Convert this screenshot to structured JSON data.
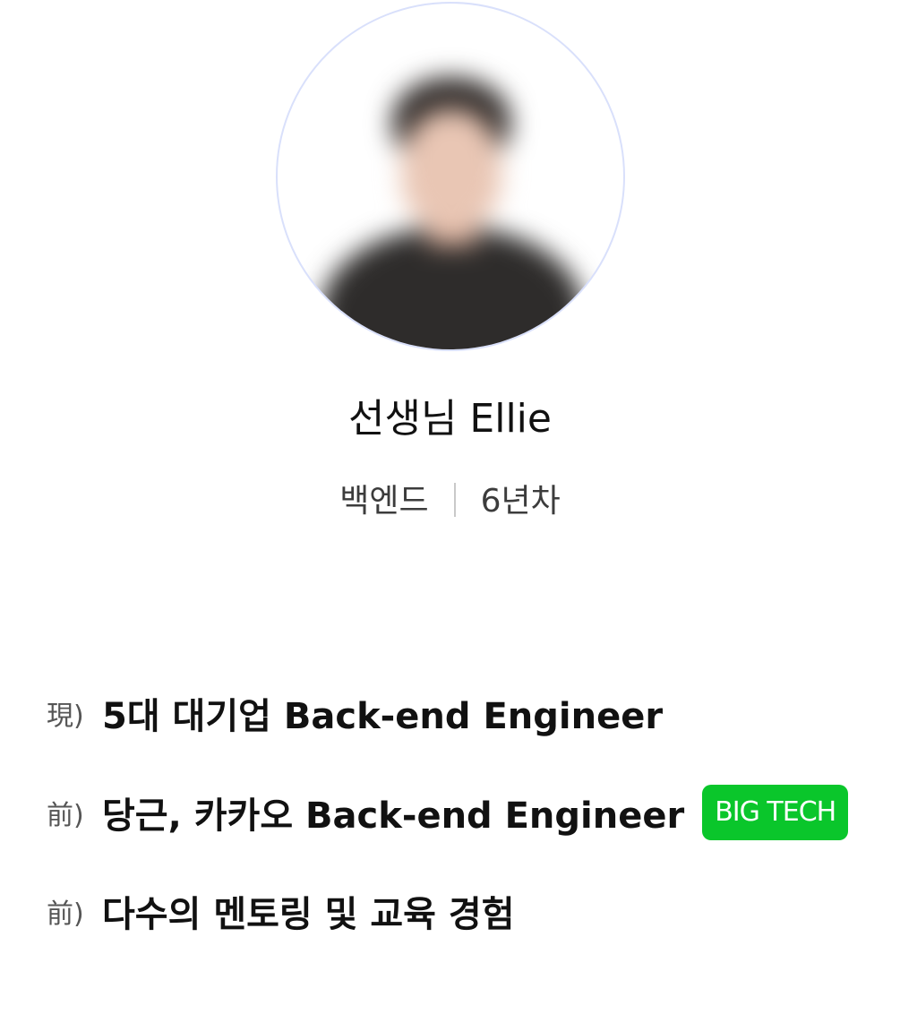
{
  "profile": {
    "avatar_alt": "profile photo",
    "name": "선생님 Ellie",
    "field": "백엔드",
    "experience": "6년차"
  },
  "career": [
    {
      "prefix": "現)",
      "text": "5대 대기업 Back-end Engineer"
    },
    {
      "prefix": "前)",
      "text": "당근, 카카오 Back-end Engineer",
      "badge": "BIG TECH"
    },
    {
      "prefix": "前)",
      "text": "다수의 멘토링 및 교육 경험"
    }
  ],
  "colors": {
    "badge_bg": "#0ac62b",
    "avatar_border": "#d9e0fb"
  }
}
